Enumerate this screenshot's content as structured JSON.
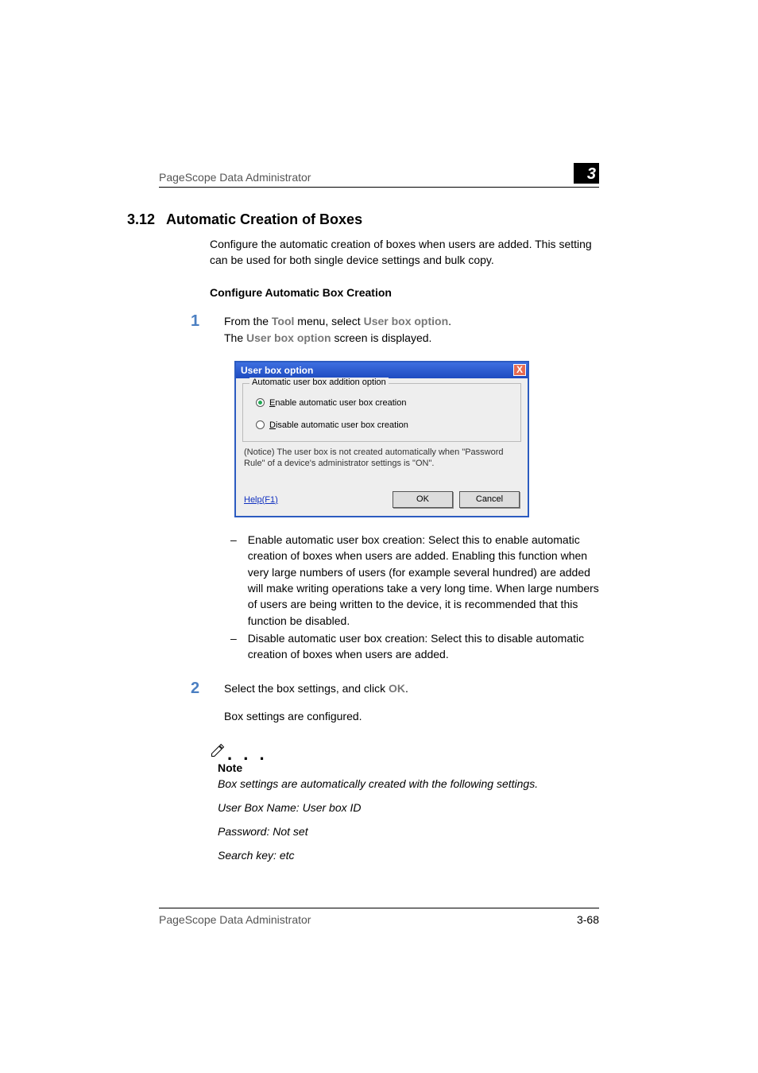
{
  "header": {
    "title": "PageScope Data Administrator",
    "chapter_number": "3"
  },
  "section": {
    "number": "3.12",
    "title": "Automatic Creation of Boxes"
  },
  "intro": "Configure the automatic creation of boxes when users are added. This setting can be used for both single device settings and bulk copy.",
  "subhead": "Configure Automatic Box Creation",
  "steps": {
    "one": {
      "num": "1",
      "line1_a": "From the ",
      "line1_tool": "Tool",
      "line1_b": " menu, select ",
      "line1_ubo": "User box option",
      "line1_c": ".",
      "line2_a": "The ",
      "line2_ubo": "User box option",
      "line2_b": " screen is displayed."
    },
    "two": {
      "num": "2",
      "line1_a": "Select the box settings, and click ",
      "line1_ok": "OK",
      "line1_b": ".",
      "line2": "Box settings are configured."
    }
  },
  "dialog": {
    "title": "User box option",
    "close": "X",
    "group_legend": "Automatic user box addition option",
    "radio_enable_prefix": "E",
    "radio_enable_rest": "nable automatic user box creation",
    "radio_disable_prefix": "D",
    "radio_disable_rest": "isable automatic user box creation",
    "notice": "(Notice) The user box is not created automatically when \"Password Rule\" of a device's administrator settings is \"ON\".",
    "help": "Help(F1)",
    "ok": "OK",
    "cancel": "Cancel"
  },
  "bullets": {
    "b1": "Enable automatic user box creation: Select this to enable automatic creation of boxes when users are added. Enabling this function when very large numbers of users (for example several hundred) are added will make writing operations take a very long time. When large numbers of users are being written to the device, it is recommended that this function be disabled.",
    "b2": "Disable automatic user box creation: Select this to disable automatic creation of boxes when users are added."
  },
  "note": {
    "label": "Note",
    "n1": "Box settings are automatically created with the following settings.",
    "n2": "User Box Name: User box ID",
    "n3": "Password: Not set",
    "n4": "Search key: etc"
  },
  "footer": {
    "title": "PageScope Data Administrator",
    "page": "3-68"
  }
}
